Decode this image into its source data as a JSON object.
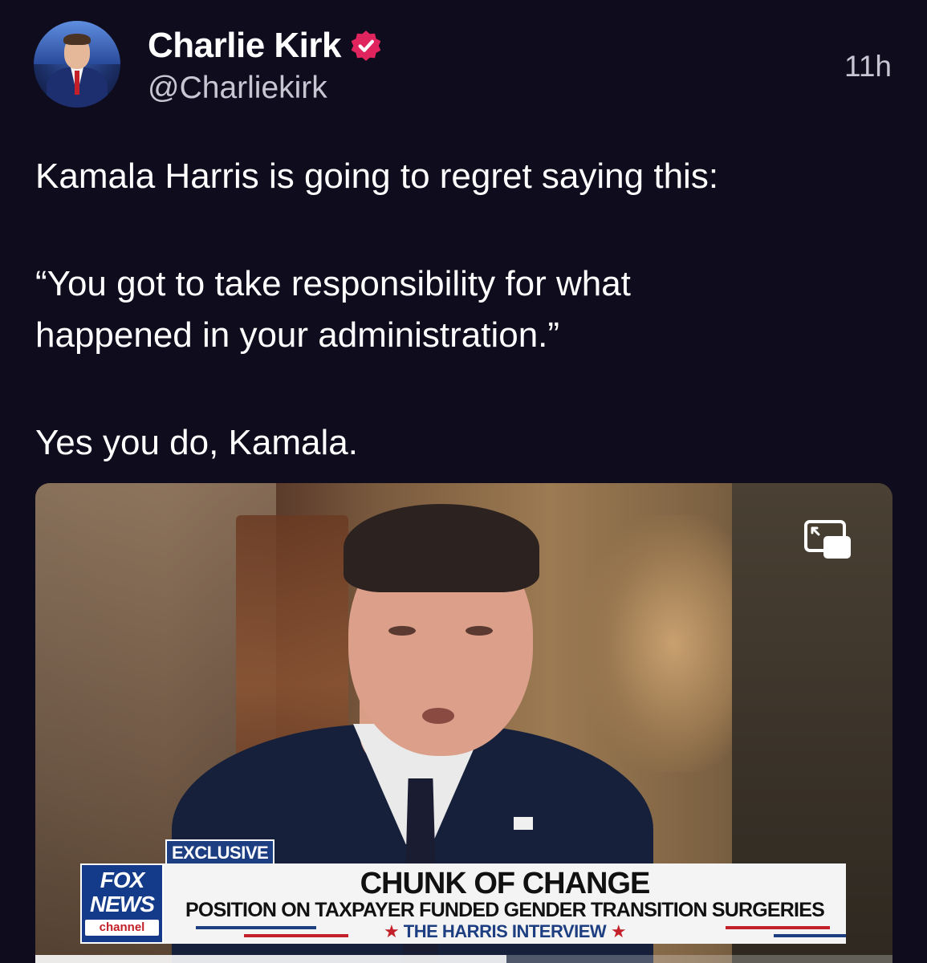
{
  "post": {
    "author": {
      "display_name": "Charlie Kirk",
      "handle": "@Charliekirk",
      "verified_icon": "verified-badge-icon",
      "verified_color": "#e0245e"
    },
    "timestamp": "11h",
    "text": {
      "line1": "Kamala Harris is going to regret saying this:",
      "line2": "“You got to take responsibility for what",
      "line3": "happened in your administration.”",
      "line4": "Yes you do, Kamala."
    },
    "media": {
      "type": "video",
      "pip_icon": "picture-in-picture-icon",
      "progress": 0.55,
      "lower_third": {
        "tag": "EXCLUSIVE",
        "network_top": "FOX",
        "network_bottom": "NEWS",
        "network_sub": "channel",
        "headline": "CHUNK OF CHANGE",
        "subheadline": "POSITION ON TAXPAYER FUNDED GENDER TRANSITION SURGERIES",
        "ticker": "THE HARRIS INTERVIEW",
        "star": "★"
      }
    }
  },
  "colors": {
    "background": "#0f0c1d",
    "text_primary": "#ffffff",
    "text_secondary": "#c9c6d3",
    "fox_blue": "#143a8a",
    "fox_red": "#c3202a"
  }
}
